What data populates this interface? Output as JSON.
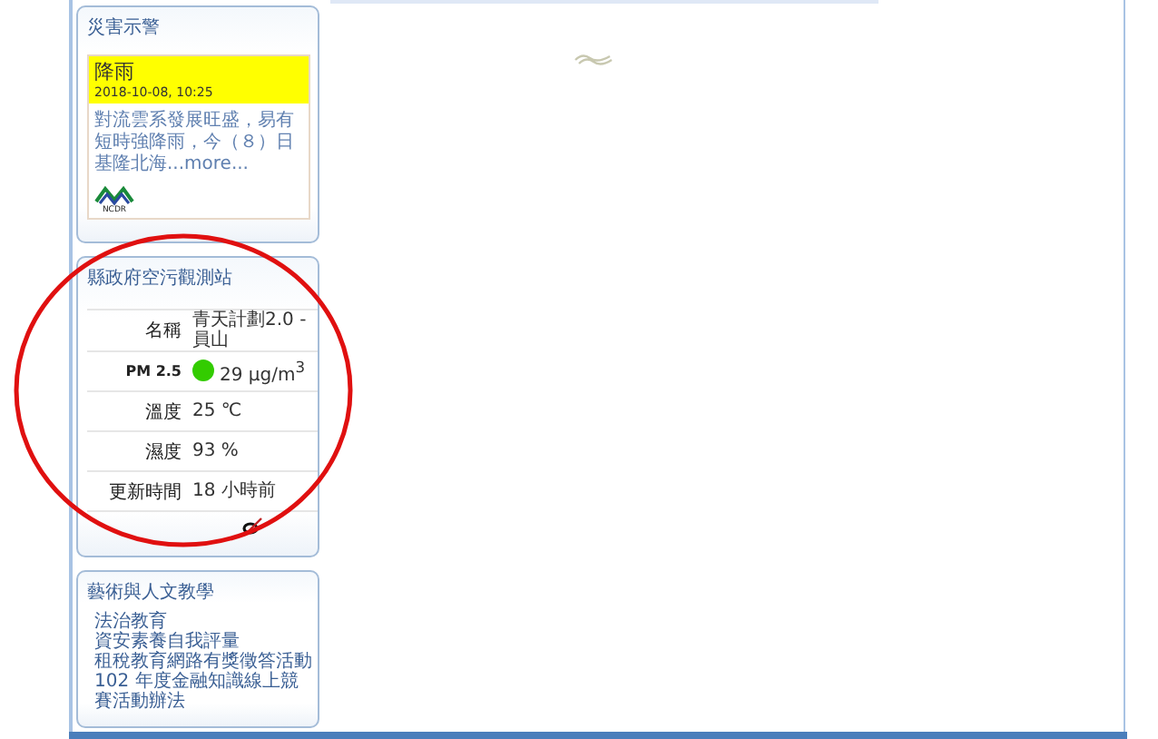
{
  "sidebar": [
    {
      "kind": "alert",
      "title": "災害示警",
      "alert": {
        "headline": "降雨",
        "time": "2018-10-08, 10:25",
        "summary": "對流雲系發展旺盛，易有短時強降雨，今（８）日基隆北海",
        "more": "...more...",
        "logo_text": "NCDR"
      }
    },
    {
      "kind": "station",
      "title": "縣政府空污觀測站",
      "rows": [
        {
          "kind": "text",
          "label": "名稱",
          "value": "青天計劃2.0 - 員山"
        },
        {
          "kind": "dot",
          "label": "PM 2.5",
          "value": "29 μg/m$^{3}$",
          "color": "#33cc00"
        },
        {
          "kind": "text",
          "label": "溫度",
          "value": "25 ℃"
        },
        {
          "kind": "text",
          "label": "濕度",
          "value": "93 %"
        },
        {
          "kind": "text",
          "label": "更新時間",
          "value": "18 小時前"
        }
      ]
    },
    {
      "kind": "links",
      "title": "藝術與人文教學",
      "links": [
        "法治教育",
        "資安素養自我評量",
        "租稅教育網路有獎徵答活動",
        "102 年度金融知識線上競賽活動辦法"
      ]
    }
  ]
}
